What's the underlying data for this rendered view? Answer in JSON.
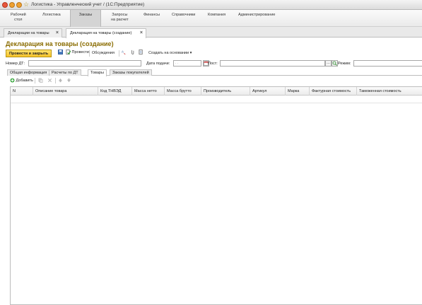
{
  "window": {
    "title": "Логистика - Управленческий учет / (1С:Предприятие)"
  },
  "sections": [
    {
      "label": "Рабочий\nстол"
    },
    {
      "label": "Логистика"
    },
    {
      "label": "Заказы"
    },
    {
      "label": "Запросы\nна расчет"
    },
    {
      "label": "Финансы"
    },
    {
      "label": "Справочники"
    },
    {
      "label": "Компания"
    },
    {
      "label": "Администрирование"
    }
  ],
  "tabs": [
    {
      "label": "Декларации на товары"
    },
    {
      "label": "Декларация на товары (создание)"
    }
  ],
  "form": {
    "title": "Декларация на товары (создание)"
  },
  "toolbar": {
    "post_close": "Провести и закрыть",
    "post": "Провести",
    "discussions": "Обсуждения",
    "create_based": "Создать на основании ▾"
  },
  "fields": {
    "number_label": "Номер ДТ:",
    "number_value": "",
    "date_label": "Дата подачи:",
    "date_placeholder": ". .",
    "post_label": "Пост:",
    "post_value": "",
    "mode_label": "Режим:",
    "mode_value": ""
  },
  "subtabs": [
    {
      "label": "Общая информация"
    },
    {
      "label": "Расчеты по ДТ"
    },
    {
      "label": "Товары"
    },
    {
      "label": "Заказы покупателей"
    }
  ],
  "grid_toolbar": {
    "add": "Добавить"
  },
  "grid": {
    "columns": [
      "N",
      "Описание товара",
      "Код ТНВЭД",
      "Масса нетто",
      "Масса брутто",
      "Производитель",
      "Артикул",
      "Марка",
      "Фактурная стоимость",
      "Таможенная стоимость"
    ],
    "rows": []
  },
  "colors": {
    "accent": "#8a6c00",
    "primary_button": "#f6c22a",
    "window_close": "#e8553b",
    "window_min": "#f0a030"
  }
}
